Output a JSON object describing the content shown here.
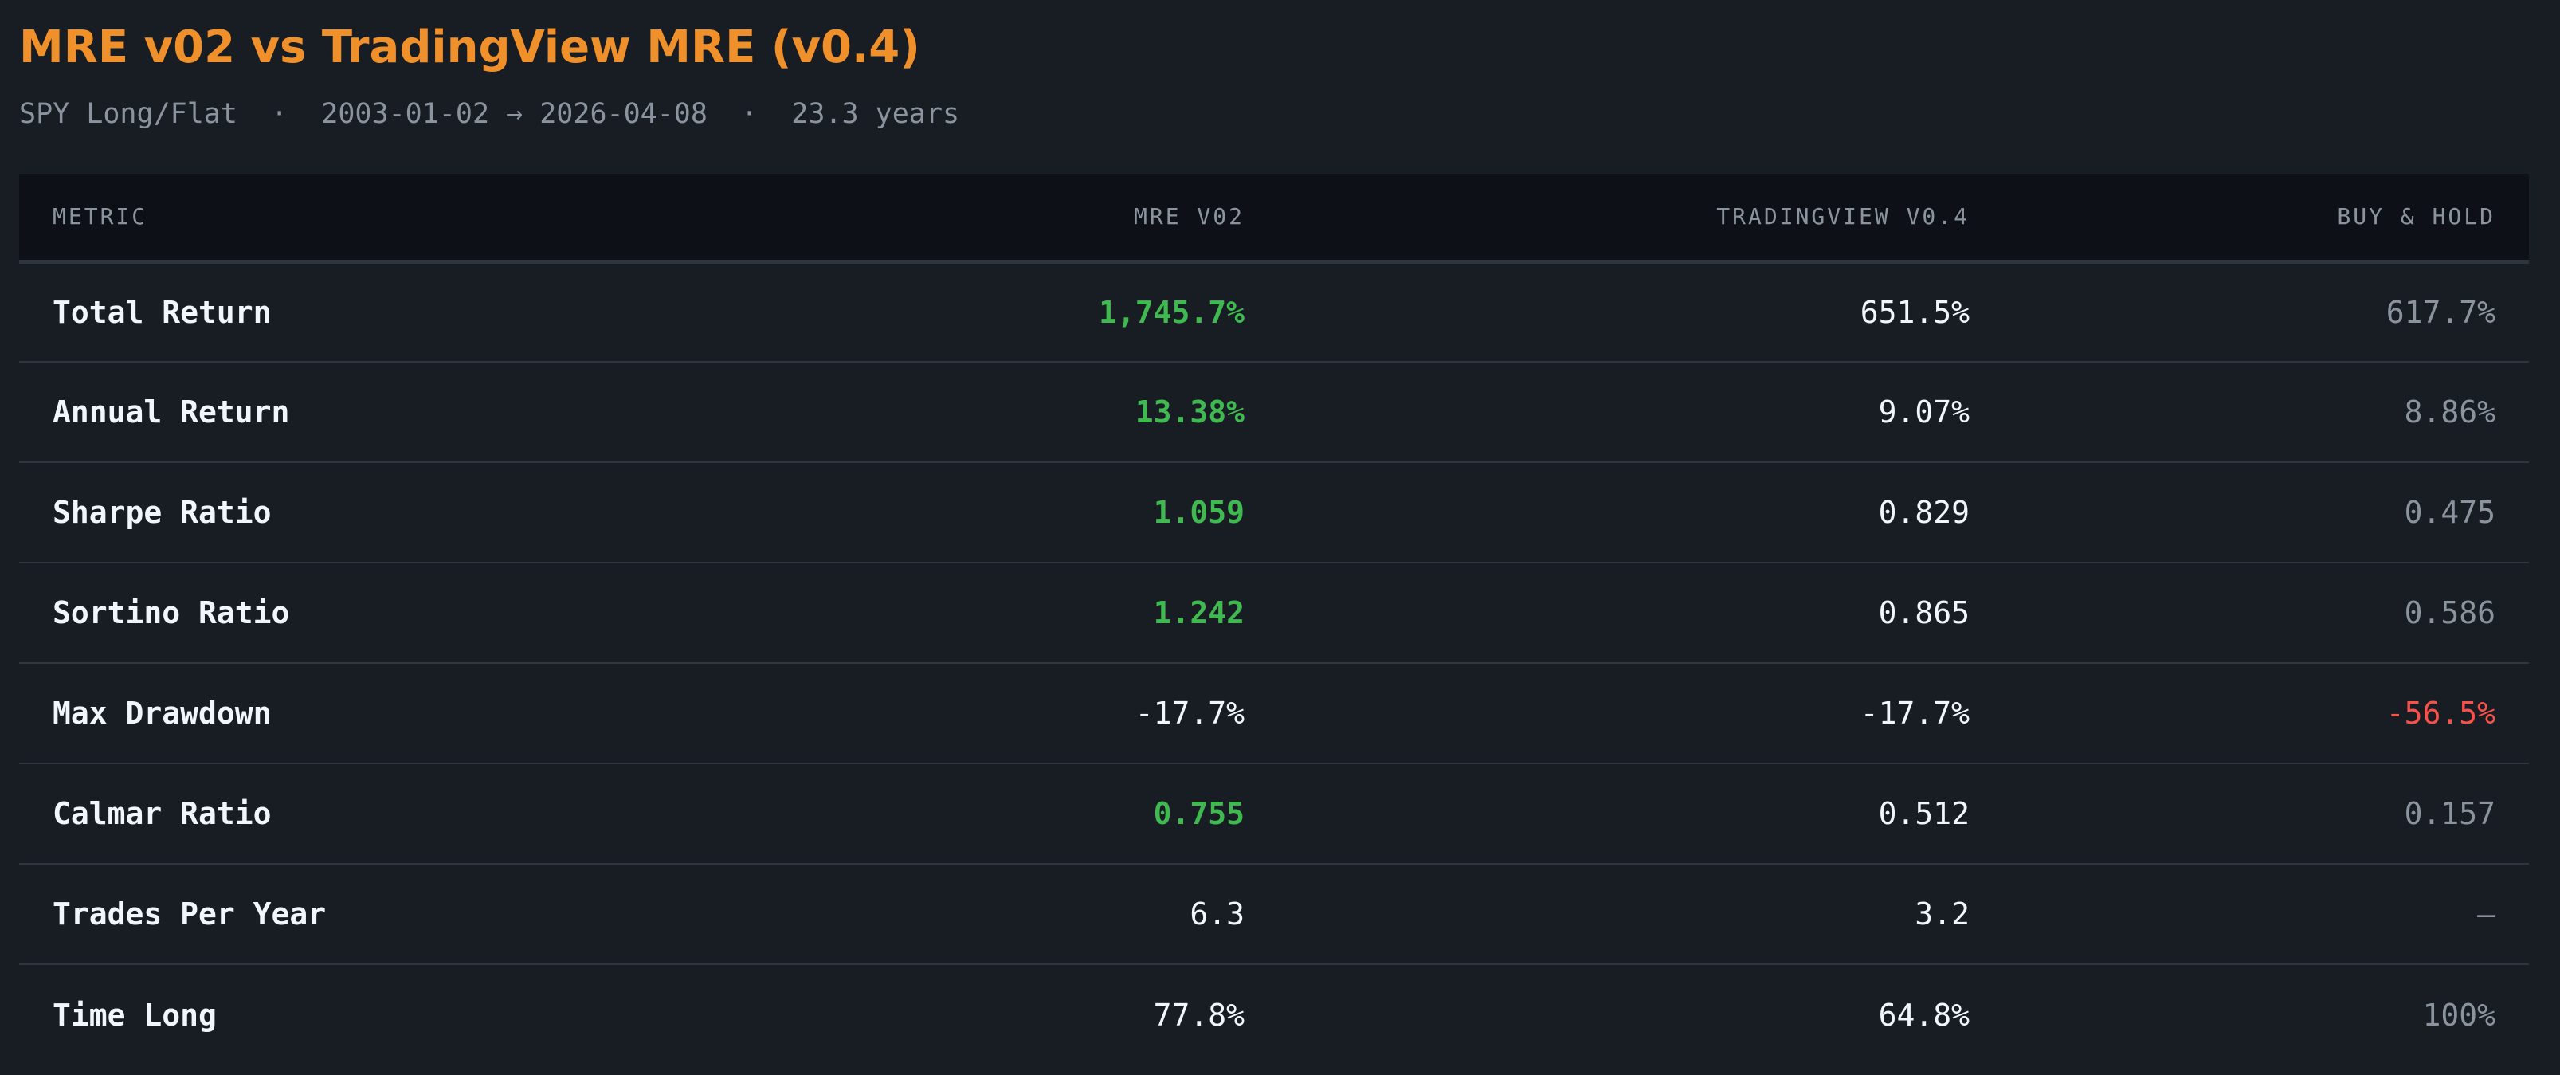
{
  "title": "MRE v02 vs TradingView MRE (v0.4)",
  "subtitle": "SPY Long/Flat  ·  2003-01-02 → 2026-04-08  ·  23.3 years",
  "colors": {
    "title": "#f0902a",
    "good": "#3fb950",
    "bad": "#f85149",
    "muted": "#8b949e"
  },
  "table": {
    "headers": [
      "Metric",
      "MRE v02",
      "TradingView v0.4",
      "Buy & Hold"
    ],
    "rows": [
      {
        "metric": "Total Return",
        "mre": "1,745.7%",
        "tv": "651.5%",
        "bh": "617.7%"
      },
      {
        "metric": "Annual Return",
        "mre": "13.38%",
        "tv": "9.07%",
        "bh": "8.86%"
      },
      {
        "metric": "Sharpe Ratio",
        "mre": "1.059",
        "tv": "0.829",
        "bh": "0.475"
      },
      {
        "metric": "Sortino Ratio",
        "mre": "1.242",
        "tv": "0.865",
        "bh": "0.586"
      },
      {
        "metric": "Max Drawdown",
        "mre": "-17.7%",
        "tv": "-17.7%",
        "bh": "-56.5%"
      },
      {
        "metric": "Calmar Ratio",
        "mre": "0.755",
        "tv": "0.512",
        "bh": "0.157"
      },
      {
        "metric": "Trades Per Year",
        "mre": "6.3",
        "tv": "3.2",
        "bh": "—"
      },
      {
        "metric": "Time Long",
        "mre": "77.8%",
        "tv": "64.8%",
        "bh": "100%"
      }
    ]
  }
}
